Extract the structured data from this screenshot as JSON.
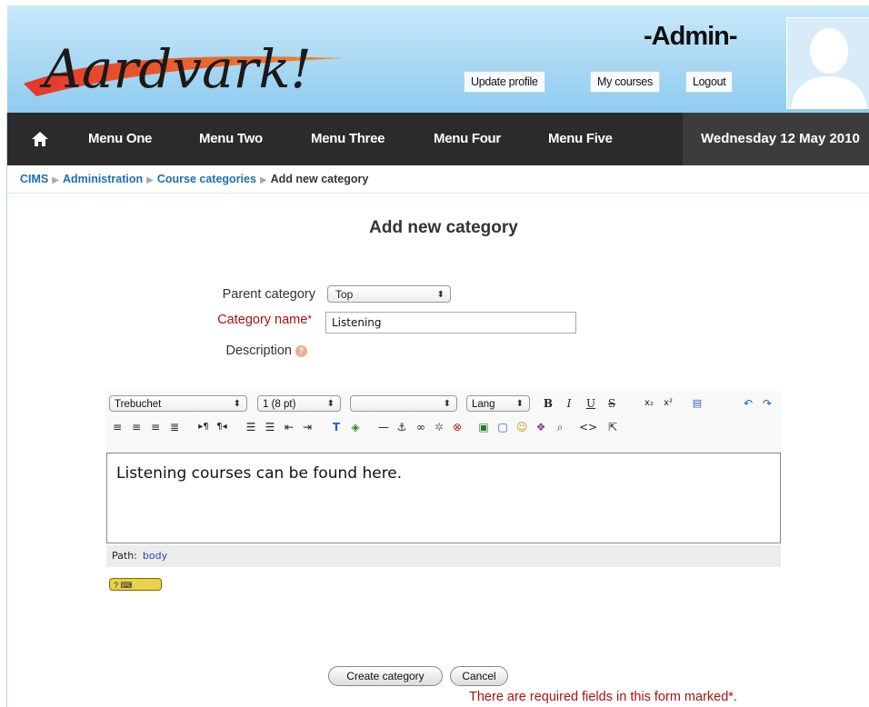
{
  "header": {
    "logo_text": "Aardvark!",
    "admin_name": "-Admin-",
    "links": [
      "Update profile",
      "My courses",
      "Logout"
    ]
  },
  "nav": {
    "items": [
      "Menu One",
      "Menu Two",
      "Menu Three",
      "Menu Four",
      "Menu Five"
    ],
    "date": "Wednesday 12 May 2010"
  },
  "breadcrumb": {
    "items": [
      "CIMS",
      "Administration",
      "Course categories"
    ],
    "current": "Add new category"
  },
  "form": {
    "title": "Add new category",
    "parent_label": "Parent category",
    "parent_value": "Top",
    "name_label": "Category name",
    "required_mark": "*",
    "name_value": "Listening",
    "description_label": "Description"
  },
  "editor": {
    "font_family": "Trebuchet",
    "font_size": "1 (8 pt)",
    "format_value": "",
    "lang_label": "Lang",
    "content": "Listening courses can be found here.",
    "path_label": "Path:",
    "path_value": "body"
  },
  "buttons": {
    "create": "Create category",
    "cancel": "Cancel"
  },
  "required_note": "There are required fields in this form marked*.",
  "colors": {
    "header_bg": "#a9d8f3",
    "nav_bg": "#2b2b2b",
    "link": "#1d6fb0",
    "required": "#aa1111"
  }
}
